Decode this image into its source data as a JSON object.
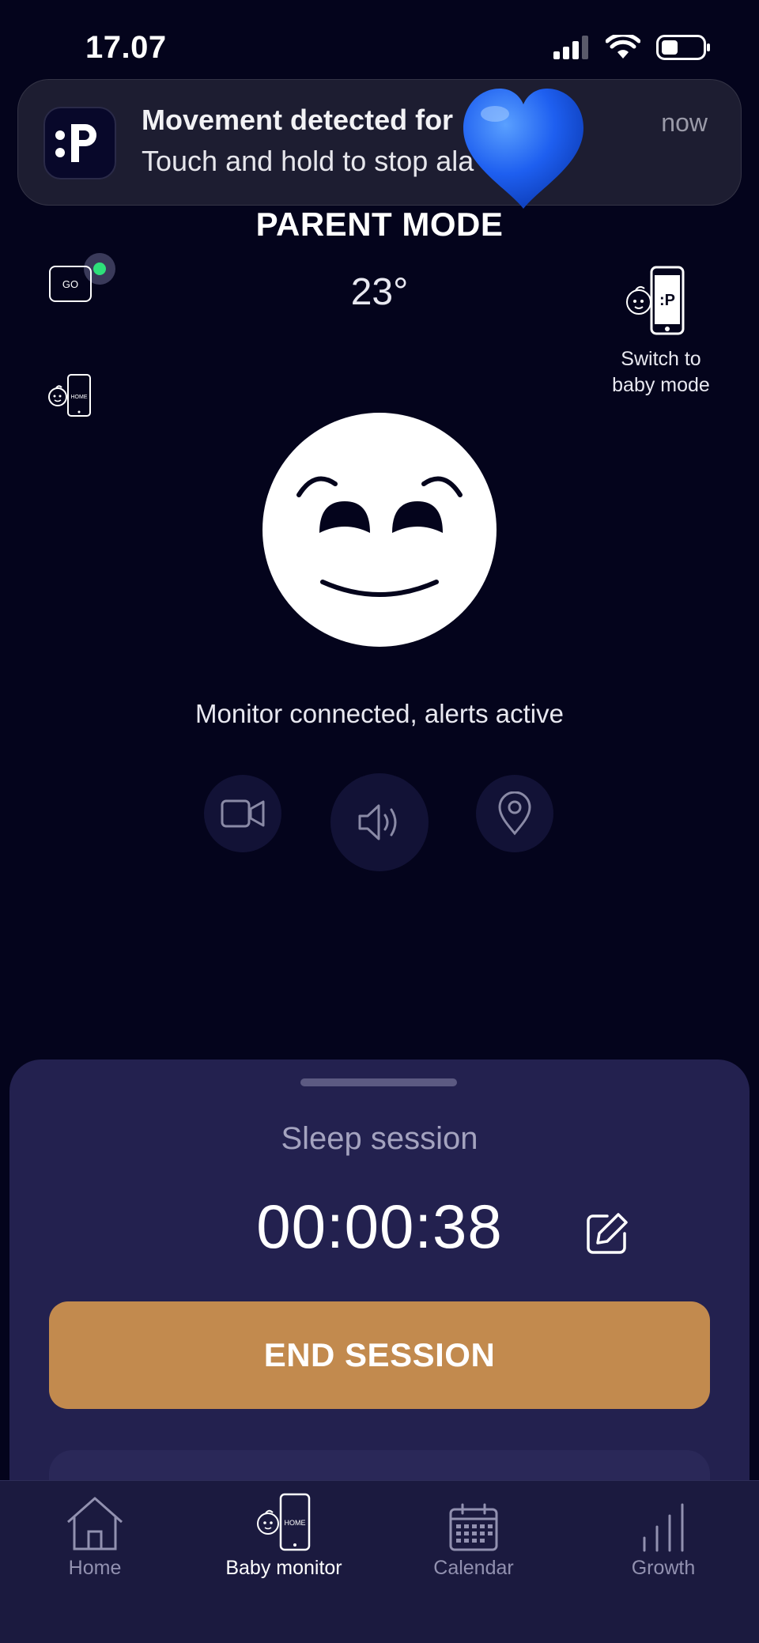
{
  "status_bar": {
    "time": "17.07"
  },
  "notification": {
    "title": "Movement detected for",
    "body": "Touch and hold to stop ala",
    "time": "now",
    "app_icon_text": ":P"
  },
  "header": {
    "title": "PARENT MODE",
    "go_label": "GO",
    "temperature": "23°",
    "switch_label_line1": "Switch to",
    "switch_label_line2": "baby mode",
    "home_badge_text": "HOME",
    "switch_icon_text": ":P"
  },
  "monitor": {
    "status_text": "Monitor connected, alerts active",
    "controls": [
      "video-icon",
      "speaker-icon",
      "location-icon"
    ]
  },
  "session": {
    "title": "Sleep session",
    "timer": "00:00:38",
    "end_label": "END SESSION"
  },
  "tabbar": {
    "items": [
      {
        "label": "Home",
        "icon": "house-icon"
      },
      {
        "label": "Baby monitor",
        "icon": "baby-monitor-icon",
        "active": true
      },
      {
        "label": "Calendar",
        "icon": "calendar-icon"
      },
      {
        "label": "Growth",
        "icon": "growth-chart-icon"
      }
    ]
  },
  "colors": {
    "background": "#04041c",
    "sheet": "#23214f",
    "accent_button": "#c28a4e",
    "online_dot": "#2ee07a",
    "heart": "#1e5ff0"
  }
}
